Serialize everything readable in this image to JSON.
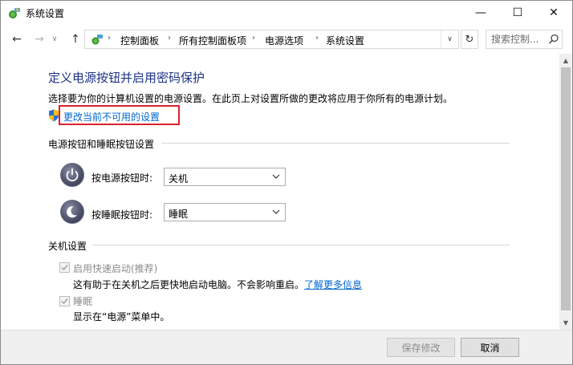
{
  "window": {
    "title": "系统设置",
    "controls": {
      "minimize": "—",
      "maximize": "☐",
      "close": "✕"
    }
  },
  "nav": {
    "back": "←",
    "forward": "→",
    "recent": "∨",
    "up": "↑",
    "breadcrumb": [
      "控制面板",
      "所有控制面板项",
      "电源选项",
      "系统设置"
    ],
    "separator": "›",
    "dropdown": "∨",
    "refresh": "↻",
    "search_placeholder": "搜索控制..."
  },
  "content": {
    "title": "定义电源按钮并启用密码保护",
    "description": "选择要为你的计算机设置的电源设置。在此页上对设置所做的更改将应用于你所有的电源计划。",
    "change_link": "更改当前不可用的设置",
    "power_section": {
      "heading": "电源按钮和睡眠按钮设置",
      "rows": [
        {
          "label": "按电源按钮时:",
          "value": "关机"
        },
        {
          "label": "按睡眠按钮时:",
          "value": "睡眠"
        }
      ]
    },
    "shutdown_section": {
      "heading": "关机设置",
      "items": [
        {
          "label": "启用快速启动(推荐)",
          "checked": true,
          "desc": "这有助于在关机之后更快地启动电脑。不会影响重启。",
          "link": "了解更多信息"
        },
        {
          "label": "睡眠",
          "checked": true,
          "desc": "显示在“电源”菜单中。"
        }
      ]
    }
  },
  "footer": {
    "save": "保存修改",
    "cancel": "取消"
  },
  "colors": {
    "title_blue": "#1e3287",
    "link_blue": "#0066cc",
    "highlight_red": "#d9232e"
  }
}
